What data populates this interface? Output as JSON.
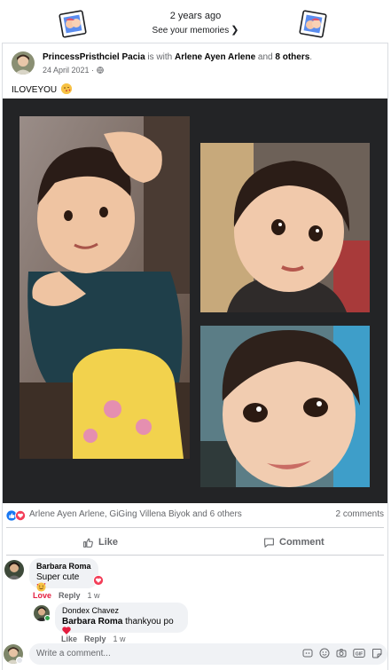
{
  "memory": {
    "years_ago": "2 years ago",
    "see_memories": "See your memories"
  },
  "post": {
    "author": "PrincessPristhciel Pacia",
    "with_text": "is with",
    "tagged": "Arlene Ayen Arlene",
    "and_text": "and",
    "others": "8 others",
    "date": "24 April 2021 ·",
    "text": "ILOVEYOU",
    "reactions_names": "Arlene Ayen Arlene, GiGing Villena Biyok and 6 others",
    "comment_count": "2 comments",
    "like_label": "Like",
    "comment_label": "Comment"
  },
  "comments": [
    {
      "name": "Barbara Roma",
      "text": "Super cute",
      "actions": {
        "love": "Love",
        "reply": "Reply",
        "time": "1 w"
      }
    },
    {
      "name": "Dondex Chavez",
      "mention": "Barbara Roma",
      "text": "thankyou po",
      "actions": {
        "like": "Like",
        "reply": "Reply",
        "time": "1 w"
      }
    }
  ],
  "composer": {
    "placeholder": "Write a comment..."
  },
  "icons": [
    "memory-frame-icon",
    "globe-icon",
    "kiss-emoji-icon",
    "like-reaction-icon",
    "love-reaction-icon",
    "thumbs-up-icon",
    "comment-icon",
    "emoji-icon",
    "camera-icon",
    "gif-icon",
    "sticker-icon"
  ],
  "colors": {
    "brand_blue": "#1877f2",
    "love_red": "#f33e58",
    "muted": "#65676b",
    "photo_bg": "#232426"
  }
}
